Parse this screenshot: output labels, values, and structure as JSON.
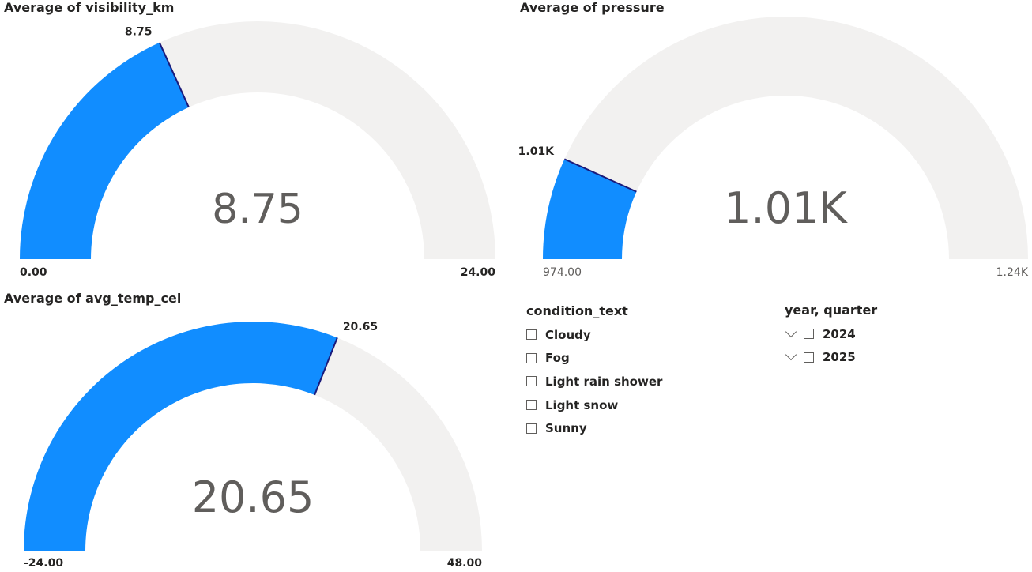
{
  "colors": {
    "fill": "#118dff",
    "track": "#f2f1f0",
    "needle": "#1a1a7a",
    "text_dark": "#252423",
    "text_gray": "#605e5c"
  },
  "gauges": {
    "visibility": {
      "title": "Average of visibility_km",
      "value": 8.75,
      "min": 0,
      "max": 24,
      "value_label": "8.75",
      "center_label": "8.75",
      "min_label": "0.00",
      "max_label": "24.00"
    },
    "pressure": {
      "title": "Average of pressure",
      "value": 1010,
      "min": 974,
      "max": 1240,
      "value_label": "1.01K",
      "center_label": "1.01K",
      "min_label": "974.00",
      "max_label": "1.24K"
    },
    "temp": {
      "title": "Average of avg_temp_cel",
      "value": 20.65,
      "min": -24,
      "max": 48,
      "value_label": "20.65",
      "center_label": "20.65",
      "min_label": "-24.00",
      "max_label": "48.00"
    }
  },
  "condition_slicer": {
    "title": "condition_text",
    "items": [
      "Cloudy",
      "Fog",
      "Light rain shower",
      "Light snow",
      "Sunny"
    ]
  },
  "year_slicer": {
    "title": "year, quarter",
    "items": [
      "2024",
      "2025"
    ]
  }
}
